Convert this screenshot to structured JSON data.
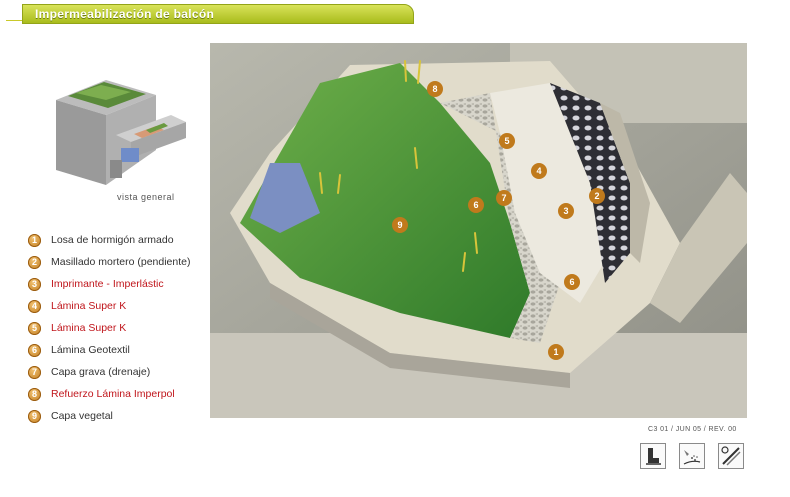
{
  "header": {
    "title": "Impermeabilización de balcón"
  },
  "overview": {
    "caption": "vista general"
  },
  "legend": {
    "items": [
      {
        "num": "1",
        "label": "Losa de hormigón armado",
        "highlight": false
      },
      {
        "num": "2",
        "label": "Masillado mortero (pendiente)",
        "highlight": false
      },
      {
        "num": "3",
        "label": "Imprimante - Imperlástic",
        "highlight": true
      },
      {
        "num": "4",
        "label": "Lámina Super K",
        "highlight": true
      },
      {
        "num": "5",
        "label": "Lámina Super K",
        "highlight": true
      },
      {
        "num": "6",
        "label": "Lámina Geotextil",
        "highlight": false
      },
      {
        "num": "7",
        "label": "Capa grava (drenaje)",
        "highlight": false
      },
      {
        "num": "8",
        "label": "Refuerzo Lámina Imperpol",
        "highlight": true
      },
      {
        "num": "9",
        "label": "Capa vegetal",
        "highlight": false
      }
    ]
  },
  "diagram": {
    "markers": [
      "8",
      "5",
      "4",
      "2",
      "7",
      "6",
      "3",
      "9",
      "6",
      "1"
    ]
  },
  "footer": {
    "revision": "C3 01 / JUN 05 / REV. 00"
  },
  "colors": {
    "accent": "#a9bc1c",
    "badge": "#c07a1c",
    "highlight_text": "#c0161c"
  }
}
